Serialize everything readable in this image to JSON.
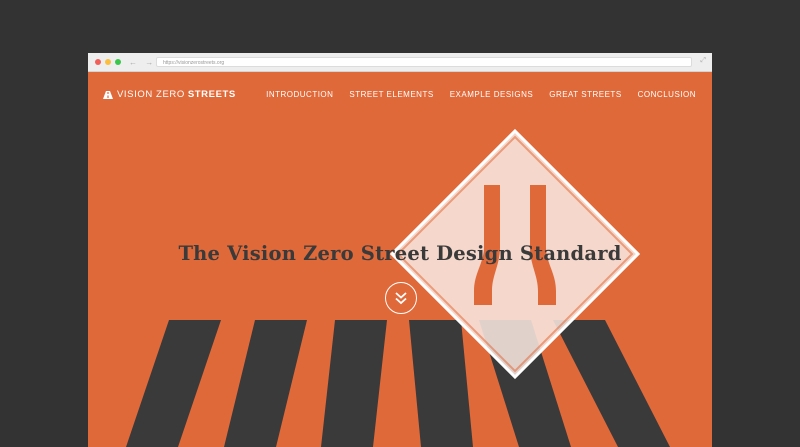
{
  "browser": {
    "url": "https://visionzerostreets.org",
    "nav_arrows": "← →",
    "resize_glyph": "⤢"
  },
  "site": {
    "logo": {
      "light": "VISION ZERO",
      "bold": "STREETS"
    },
    "nav": [
      {
        "label": "INTRODUCTION"
      },
      {
        "label": "STREET ELEMENTS"
      },
      {
        "label": "EXAMPLE DESIGNS"
      },
      {
        "label": "GREAT STREETS"
      },
      {
        "label": "CONCLUSION"
      }
    ],
    "hero": {
      "title": "The Vision Zero Street Design Standard",
      "scroll_icon": "chevron-double-down-icon"
    }
  },
  "colors": {
    "background": "#333333",
    "brand_orange": "#e0693a",
    "stripe_dark": "#3a3a3a",
    "sign_fill": "#f7e6df",
    "white": "#ffffff"
  }
}
